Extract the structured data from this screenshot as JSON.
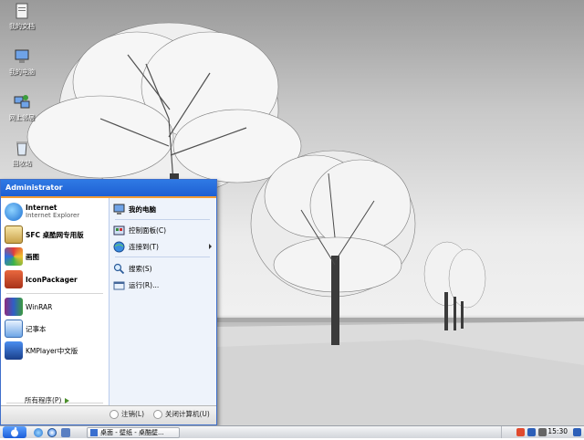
{
  "desktop_icons": [
    {
      "label": "我的文档",
      "icon": "my-documents-icon"
    },
    {
      "label": "我的电脑",
      "icon": "my-computer-icon"
    },
    {
      "label": "网上邻居",
      "icon": "network-places-icon"
    },
    {
      "label": "回收站",
      "icon": "recycle-bin-icon"
    }
  ],
  "start_menu": {
    "user": "Administrator",
    "pinned": [
      {
        "title": "Internet",
        "subtitle": "Internet Explorer",
        "icon": "internet-explorer-icon"
      },
      {
        "title": "SFC 桌酷网专用版",
        "icon": "sfc-icon"
      },
      {
        "title": "画图",
        "icon": "paint-icon"
      },
      {
        "title": "IconPackager",
        "icon": "iconpackager-icon"
      }
    ],
    "recent": [
      {
        "title": "WinRAR",
        "icon": "winrar-icon"
      },
      {
        "title": "记事本",
        "icon": "notepad-icon"
      },
      {
        "title": "KMPlayer中文版",
        "icon": "kmplayer-icon"
      }
    ],
    "all_programs": "所有程序(P)",
    "right": [
      {
        "label": "我的电脑",
        "icon": "my-computer-icon"
      },
      {
        "label": "控制面板(C)",
        "icon": "control-panel-icon"
      },
      {
        "label": "连接到(T)",
        "icon": "connect-to-icon"
      },
      {
        "label": "搜索(S)",
        "icon": "search-icon"
      },
      {
        "label": "运行(R)...",
        "icon": "run-icon"
      }
    ],
    "logoff": "注销(L)",
    "shutdown": "关闭计算机(U)"
  },
  "taskbar": {
    "window_title": "桌面 - 壁纸 - 桌酷壁...",
    "clock": "15:30"
  },
  "colors": {
    "header_blue": "#1e5fd3",
    "accent_orange": "#f39c35",
    "right_pane": "#eef3fb"
  }
}
